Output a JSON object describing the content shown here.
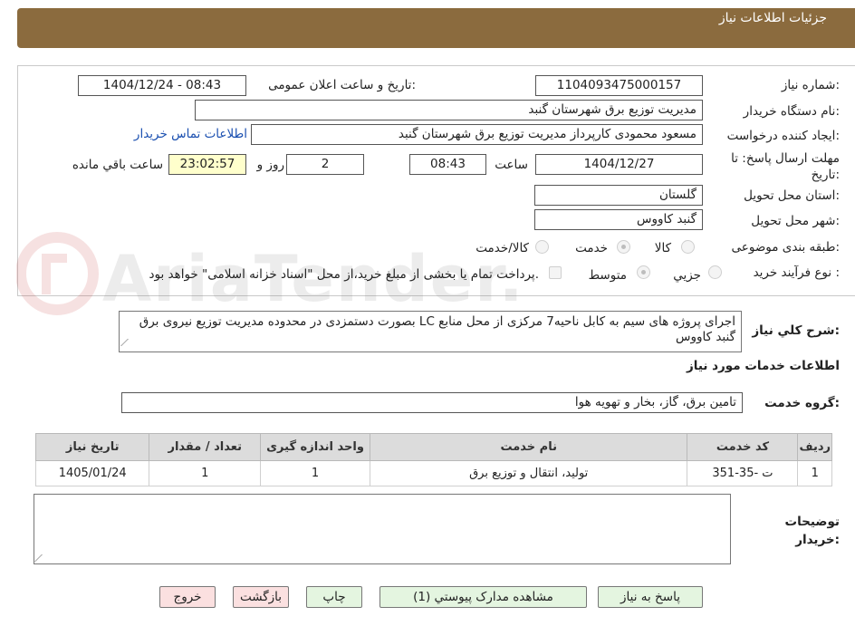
{
  "header": {
    "title": "جزئیات اطلاعات نیاز"
  },
  "form": {
    "need_number_label": "شماره نیاز:",
    "need_number": "1104093475000157",
    "announce_label": "تاریخ و ساعت اعلان عمومی:",
    "announce_value": "1404/12/24 - 08:43",
    "buyer_org_label": "نام دستگاه خریدار:",
    "buyer_org": "مدیریت توزیع برق شهرستان گنبد",
    "requester_label": "ایجاد کننده درخواست:",
    "requester": "مسعود محمودی کارپرداز مدیریت توزیع برق شهرستان گنبد",
    "contact_link": "اطلاعات تماس خریدار",
    "deadline_label": "مهلت ارسال پاسخ: تا تاریخ:",
    "deadline_date": "1404/12/27",
    "time_label": "ساعت",
    "deadline_time": "08:43",
    "days_value": "2",
    "days_label": "روز و",
    "remaining_time": "23:02:57",
    "remaining_label": "ساعت باقي مانده",
    "province_label": "استان محل تحویل:",
    "province": "گلستان",
    "city_label": "شهر محل تحویل:",
    "city": "گنبد کاووس",
    "category_label": "طبقه بندی موضوعی:",
    "category_options": [
      "کالا",
      "خدمت",
      "کالا/خدمت"
    ],
    "category_selected": "خدمت",
    "process_label": "نوع فرآیند خرید :",
    "process_options": [
      "جزيي",
      "متوسط"
    ],
    "process_selected": "متوسط",
    "payment_note": "پرداخت تمام یا بخشی از مبلغ خرید،از محل \"اسناد خزانه اسلامی\" خواهد بود."
  },
  "description": {
    "label": "شرح کلي نیاز:",
    "text": "اجرای پروژه های سیم به کابل ناحیه7 مرکزی از محل منابع LC بصورت دستمزدی در محدوده مدیریت توزیع نیروی برق گنبد کاووس"
  },
  "services": {
    "section_title": "اطلاعات خدمات مورد نیاز",
    "group_label": "گروه خدمت:",
    "group_value": "تامین برق، گاز، بخار و تهویه هوا",
    "columns": [
      "ردیف",
      "کد خدمت",
      "نام خدمت",
      "واحد اندازه گیری",
      "تعداد / مقدار",
      "تاریخ نیاز"
    ],
    "rows": [
      {
        "row": "1",
        "code": "ت -35-351",
        "name": "تولید، انتقال و توزیع برق",
        "unit": "1",
        "qty": "1",
        "date": "1405/01/24"
      }
    ]
  },
  "buyer_notes": {
    "label": "توضیحات خریدار:",
    "value": ""
  },
  "buttons": {
    "reply": "پاسخ به نیاز",
    "attachments": "مشاهده مدارک پیوستي (1)",
    "print": "چاپ",
    "back": "بازگشت",
    "exit": "خروج"
  },
  "colors": {
    "header_bg": "#8b6b3e",
    "link": "#1a4fb0",
    "remaining_bg": "#ffffcc"
  },
  "watermark": "AriaTender.neT"
}
